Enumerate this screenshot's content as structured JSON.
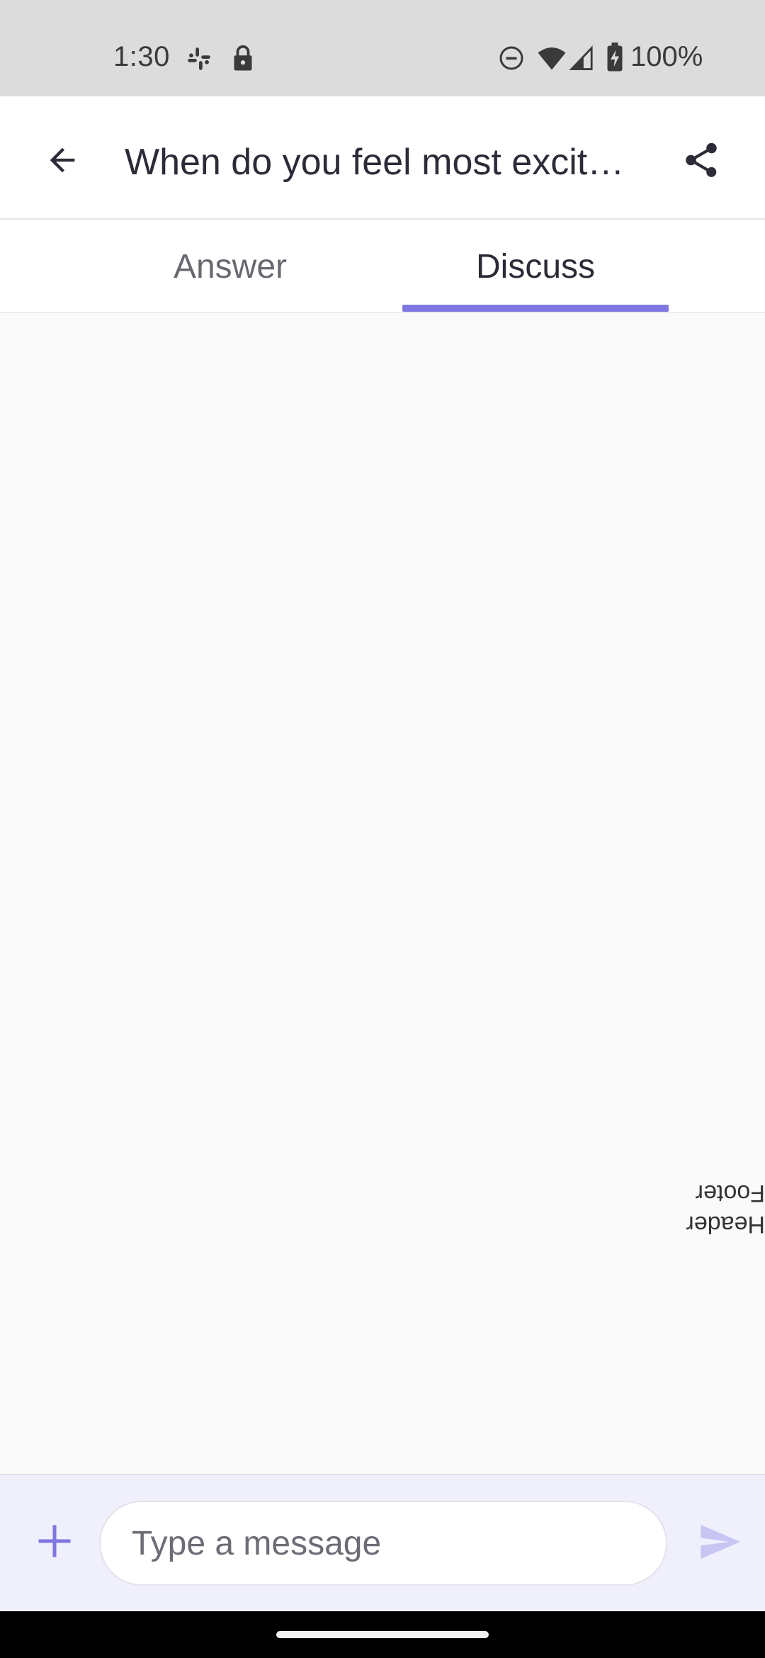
{
  "status_bar": {
    "time": "1:30",
    "battery": "100%",
    "icons": [
      "slack-icon",
      "lock-icon",
      "do-not-disturb-icon",
      "wifi-icon",
      "signal-icon",
      "battery-charging-icon"
    ]
  },
  "app_bar": {
    "title": "When do you feel most excit…",
    "back_icon": "arrow-back-icon",
    "share_icon": "share-icon"
  },
  "tabs": [
    {
      "label": "Answer",
      "selected": false
    },
    {
      "label": "Discuss",
      "selected": true
    }
  ],
  "content": {
    "labels": [
      "Header",
      "Footer"
    ]
  },
  "composer": {
    "placeholder": "Type a message",
    "add_icon": "plus-icon",
    "send_icon": "send-icon"
  },
  "colors": {
    "accent": "#7f77e0",
    "status_bar_bg": "#dcdcdc",
    "composer_bg": "#f0effc"
  }
}
